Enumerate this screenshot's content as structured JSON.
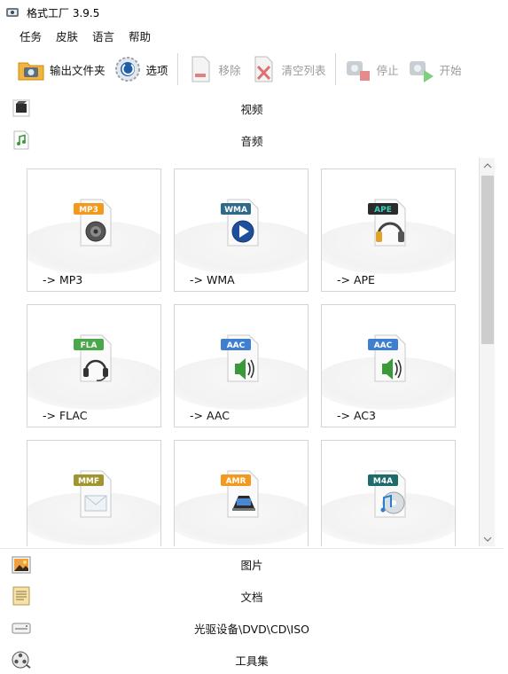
{
  "window": {
    "title": "格式工厂 3.9.5"
  },
  "menu": [
    {
      "label": "任务"
    },
    {
      "label": "皮肤"
    },
    {
      "label": "语言"
    },
    {
      "label": "帮助"
    }
  ],
  "toolbar": {
    "output_folder": "输出文件夹",
    "options": "选项",
    "remove": "移除",
    "clear_list": "清空列表",
    "stop": "停止",
    "start": "开始"
  },
  "categories": {
    "video": "视频",
    "audio": "音频",
    "image": "图片",
    "document": "文档",
    "optical": "光驱设备\\DVD\\CD\\ISO",
    "tools": "工具集"
  },
  "audio_formats": [
    {
      "badge": "MP3",
      "label": "-> MP3",
      "badge_color": "#f39a1e",
      "emblem": "speaker"
    },
    {
      "badge": "WMA",
      "label": "-> WMA",
      "badge_color": "#2e6a8a",
      "emblem": "play"
    },
    {
      "badge": "APE",
      "label": "-> APE",
      "badge_color": "#2b2b2b",
      "emblem": "headphones"
    },
    {
      "badge": "FLA",
      "label": "-> FLAC",
      "badge_color": "#4aa84a",
      "emblem": "headset"
    },
    {
      "badge": "AAC",
      "label": "-> AAC",
      "badge_color": "#3f7fd0",
      "emblem": "sound"
    },
    {
      "badge": "AAC",
      "label": "-> AC3",
      "badge_color": "#3f7fd0",
      "emblem": "sound"
    },
    {
      "badge": "MMF",
      "label": "",
      "badge_color": "#a0952e",
      "emblem": "envelope"
    },
    {
      "badge": "AMR",
      "label": "",
      "badge_color": "#f39a1e",
      "emblem": "phone"
    },
    {
      "badge": "M4A",
      "label": "",
      "badge_color": "#1f6b6b",
      "emblem": "music"
    }
  ],
  "colors": {
    "disabled_text": "#9a9a9a",
    "tile_border": "#d4d4d4",
    "scroll_thumb": "#cdcdcd"
  }
}
